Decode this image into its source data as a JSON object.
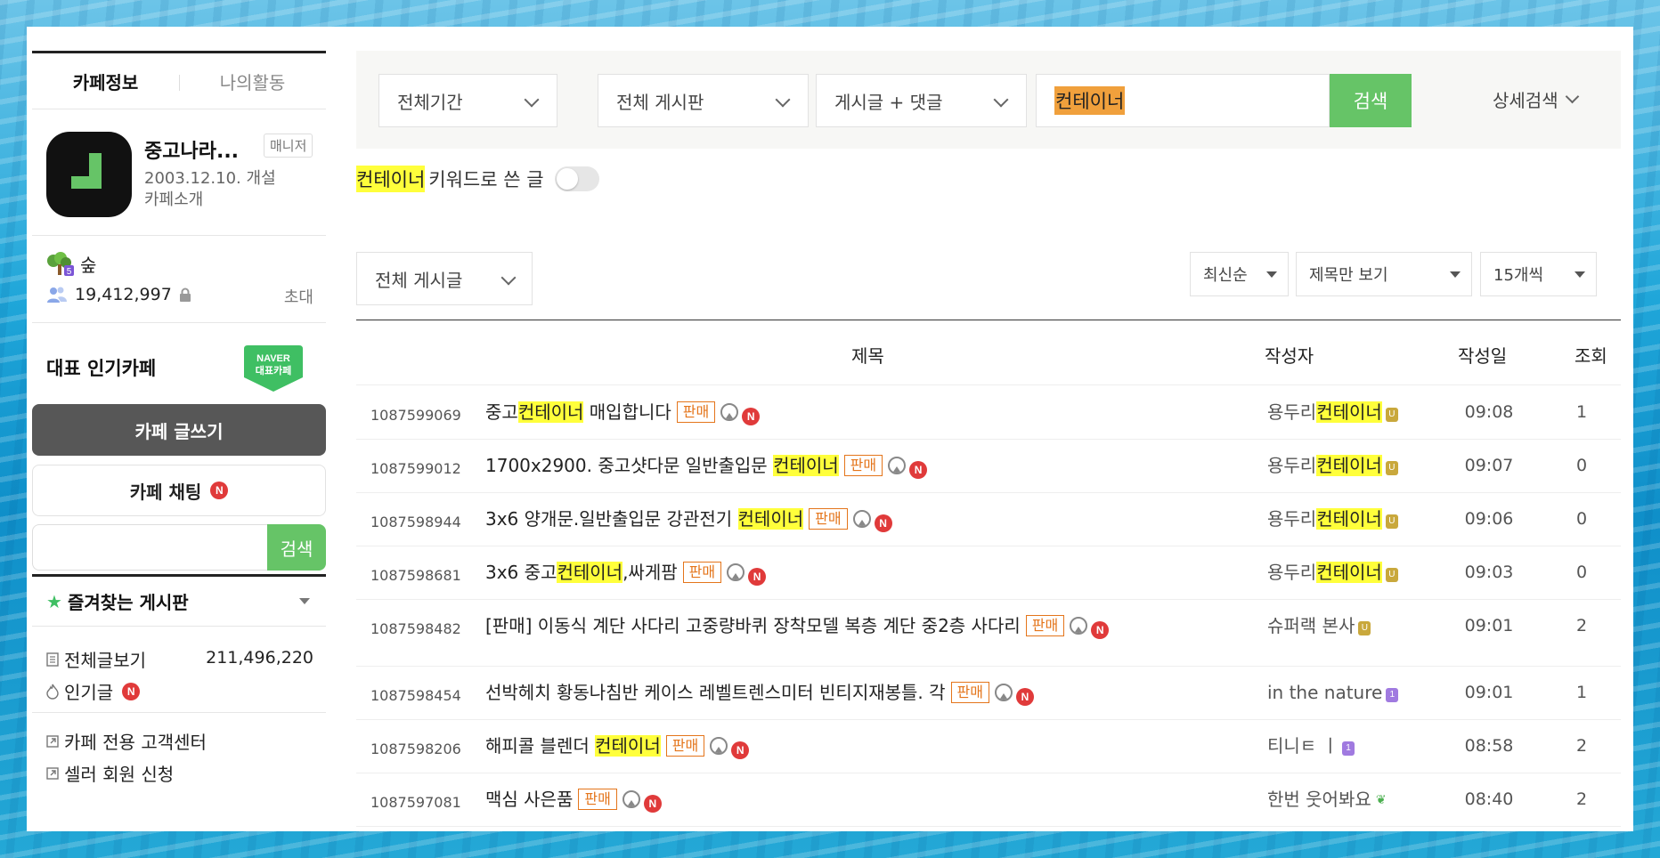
{
  "sidebar": {
    "tabs": [
      "카페정보",
      "나의활동"
    ],
    "cafe": {
      "name": "중고나라...",
      "manager_badge": "매니저",
      "founded": "2003.12.10. 개설",
      "intro": "카페소개"
    },
    "grade": "숲",
    "grade_level": "5",
    "members": "19,412,997",
    "invite": "초대",
    "popular_label": "대표 인기카페",
    "naver_badge_line1": "NAVER",
    "naver_badge_line2": "대표카페",
    "write_button": "카페 글쓰기",
    "chat_button": "카페 채팅",
    "search_button": "검색",
    "search_placeholder": "",
    "favorites_title": "즐겨찾는 게시판",
    "menu": [
      {
        "label": "전체글보기",
        "count": "211,496,220"
      },
      {
        "label": "인기글"
      },
      {
        "label": "카페 전용 고객센터"
      },
      {
        "label": "셀러 회원 신청"
      }
    ]
  },
  "search": {
    "period": "전체기간",
    "board": "전체 게시판",
    "scope": "게시글 + 댓글",
    "query": "컨테이너",
    "button": "검색",
    "advanced": "상세검색"
  },
  "keyword_toggle": {
    "keyword": "컨테이너",
    "text": "키워드로 쓴 글"
  },
  "filters": {
    "board": "전체 게시글",
    "sort": "최신순",
    "view": "제목만 보기",
    "per_page": "15개씩"
  },
  "table": {
    "headers": {
      "title": "제목",
      "author": "작성자",
      "date": "작성일",
      "views": "조회"
    },
    "tag_label": "판매",
    "new_label": "N",
    "rows": [
      {
        "id": "1087599069",
        "pre": "중고",
        "hl": "컨테이너",
        "post": " 매입합니다",
        "a_pre": "용두리",
        "a_hl": "컨테이너",
        "a_post": "",
        "level": "gold",
        "date": "09:08",
        "views": "1"
      },
      {
        "id": "1087599012",
        "pre": "1700x2900. 중고샷다문 일반출입문 ",
        "hl": "컨테이너",
        "post": "",
        "a_pre": "용두리",
        "a_hl": "컨테이너",
        "a_post": "",
        "level": "gold",
        "date": "09:07",
        "views": "0"
      },
      {
        "id": "1087598944",
        "pre": "3x6 양개문.일반출입문 강관전기 ",
        "hl": "컨테이너",
        "post": "",
        "a_pre": "용두리",
        "a_hl": "컨테이너",
        "a_post": "",
        "level": "gold",
        "date": "09:06",
        "views": "0"
      },
      {
        "id": "1087598681",
        "pre": "3x6 중고",
        "hl": "컨테이너",
        "post": ",싸게팜",
        "a_pre": "용두리",
        "a_hl": "컨테이너",
        "a_post": "",
        "level": "gold",
        "date": "09:03",
        "views": "0"
      },
      {
        "id": "1087598482",
        "pre": "[판매] 이동식 계단 사다리 고중량바퀴 장착모델 복층 계단 중2층 사다리",
        "hl": "",
        "post": "",
        "a_pre": "슈퍼랙 본사",
        "a_hl": "",
        "a_post": "",
        "level": "gold",
        "date": "09:01",
        "views": "2"
      },
      {
        "id": "1087598454",
        "pre": "선박헤치 황동나침반 케이스 레벨트렌스미터 빈티지재봉틀. 각",
        "hl": "",
        "post": "",
        "a_pre": "in the nature",
        "a_hl": "",
        "a_post": "",
        "level": "purple",
        "date": "09:01",
        "views": "1"
      },
      {
        "id": "1087598206",
        "pre": "해피콜 블렌더 ",
        "hl": "컨테이너",
        "post": "",
        "a_pre": "티니ㅌ ㅣ",
        "a_hl": "",
        "a_post": "",
        "level": "purple",
        "date": "08:58",
        "views": "2"
      },
      {
        "id": "1087597081",
        "pre": "맥심 사은품",
        "hl": "",
        "post": "",
        "a_pre": "한번 웃어봐요",
        "a_hl": "",
        "a_post": "",
        "level": "sprout",
        "date": "08:40",
        "views": "2"
      }
    ]
  }
}
